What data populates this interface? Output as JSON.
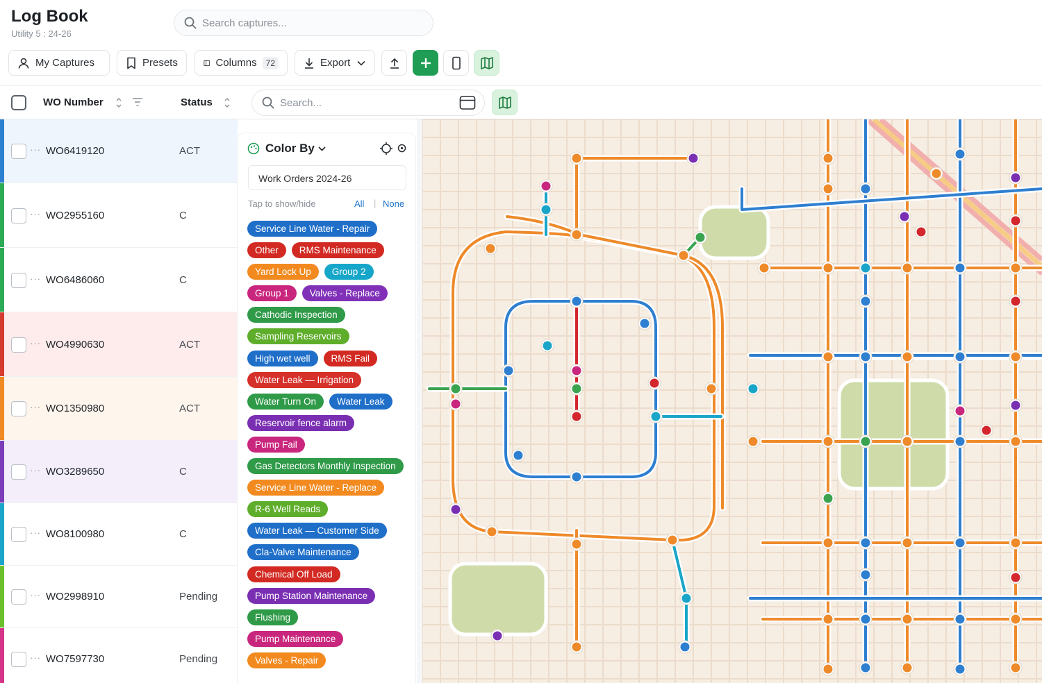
{
  "header": {
    "title": "Log Book",
    "subtitle": "Utility 5 : 24-26",
    "search_placeholder": "Search captures..."
  },
  "toolbar": {
    "my_captures": "My Captures",
    "presets": "Presets",
    "columns": "Columns",
    "columns_count": "72",
    "export": "Export"
  },
  "grid": {
    "col_wo": "WO Number",
    "col_status": "Status",
    "search_placeholder": "Search...",
    "rows": [
      {
        "wo": "WO6419120",
        "status": "ACT",
        "color": "#2d7fd1",
        "bg": "#eef5fd"
      },
      {
        "wo": "WO2955160",
        "status": "C",
        "color": "#2bab55",
        "bg": "#ffffff"
      },
      {
        "wo": "WO6486060",
        "status": "C",
        "color": "#2bab55",
        "bg": "#ffffff"
      },
      {
        "wo": "WO4990630",
        "status": "ACT",
        "color": "#d63b2f",
        "bg": "#fdeceb"
      },
      {
        "wo": "WO1350980",
        "status": "ACT",
        "color": "#f08a24",
        "bg": "#fef5ec"
      },
      {
        "wo": "WO3289650",
        "status": "C",
        "color": "#7b3db8",
        "bg": "#f4eefb"
      },
      {
        "wo": "WO8100980",
        "status": "C",
        "color": "#1aa5c8",
        "bg": "#ffffff"
      },
      {
        "wo": "WO2998910",
        "status": "Pending",
        "color": "#6bbf2a",
        "bg": "#ffffff"
      },
      {
        "wo": "WO7597730",
        "status": "Pending",
        "color": "#d6338a",
        "bg": "#ffffff"
      }
    ]
  },
  "color_by": {
    "title": "Color By",
    "selected": "Work Orders 2024-26",
    "hint": "Tap to show/hide",
    "all": "All",
    "sep": "|",
    "none": "None",
    "chip_rows": [
      [
        {
          "label": "Service Line Water - Repair",
          "color": "#1f6fc9"
        }
      ],
      [
        {
          "label": "Other",
          "color": "#d22a22"
        },
        {
          "label": "RMS Maintenance",
          "color": "#d22a22"
        }
      ],
      [
        {
          "label": "Yard Lock Up",
          "color": "#f28a1f"
        },
        {
          "label": "Group 2",
          "color": "#16a6c9"
        }
      ],
      [
        {
          "label": "Group 1",
          "color": "#c9267e"
        },
        {
          "label": "Valves - Replace",
          "color": "#8131b8"
        }
      ],
      [
        {
          "label": "Cathodic Inspection",
          "color": "#2f9a48"
        }
      ],
      [
        {
          "label": "Sampling Reservoirs",
          "color": "#5fae2b"
        }
      ],
      [
        {
          "label": "High wet well",
          "color": "#1f6fc9"
        },
        {
          "label": "RMS Fail",
          "color": "#d22a22"
        }
      ],
      [
        {
          "label": "Water Leak — Irrigation",
          "color": "#d6302a"
        }
      ],
      [
        {
          "label": "Water Turn On",
          "color": "#2f9a48"
        },
        {
          "label": "Water Leak",
          "color": "#1f6fc9"
        }
      ],
      [
        {
          "label": "Reservoir fence alarm",
          "color": "#7a2fb3"
        }
      ],
      [
        {
          "label": "Pump Fail",
          "color": "#c9267e"
        }
      ],
      [
        {
          "label": "Gas Detectors Monthly Inspection",
          "color": "#2f9a48"
        }
      ],
      [
        {
          "label": "Service Line Water - Replace",
          "color": "#f28a1f"
        }
      ],
      [
        {
          "label": "R-6 Well Reads",
          "color": "#5fae2b"
        }
      ],
      [
        {
          "label": "Water Leak — Customer Side",
          "color": "#1f6fc9"
        }
      ],
      [
        {
          "label": "Cla-Valve Maintenance",
          "color": "#1f6fc9"
        }
      ],
      [
        {
          "label": "Chemical Off Load",
          "color": "#d22a22"
        }
      ],
      [
        {
          "label": "Pump Station Maintenance",
          "color": "#7a2fb3"
        }
      ],
      [
        {
          "label": "Flushing",
          "color": "#2f9a48"
        }
      ],
      [
        {
          "label": "Pump Maintenance",
          "color": "#c9267e"
        }
      ],
      [
        {
          "label": "Valves - Repair",
          "color": "#f28a1f"
        }
      ]
    ]
  },
  "map": {
    "colors": {
      "orange": "#ee8a2a",
      "blue": "#2f7fd0",
      "green": "#3aa34f",
      "red": "#d3262d",
      "purple": "#7a2fb3",
      "magenta": "#c9267e",
      "teal": "#1aa5c8",
      "park": "#cfdcaa"
    }
  }
}
